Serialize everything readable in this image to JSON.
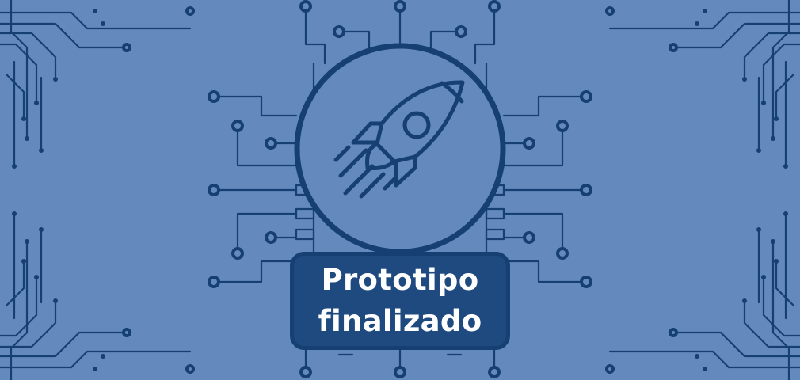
{
  "banner": {
    "icon": "rocket-icon",
    "label_lines": [
      "Prototipo",
      "finalizado"
    ]
  },
  "colors": {
    "background": "#6389bd",
    "circuit": "#163f73",
    "label_background": "#1e4a7f",
    "label_text": "#ffffff"
  }
}
